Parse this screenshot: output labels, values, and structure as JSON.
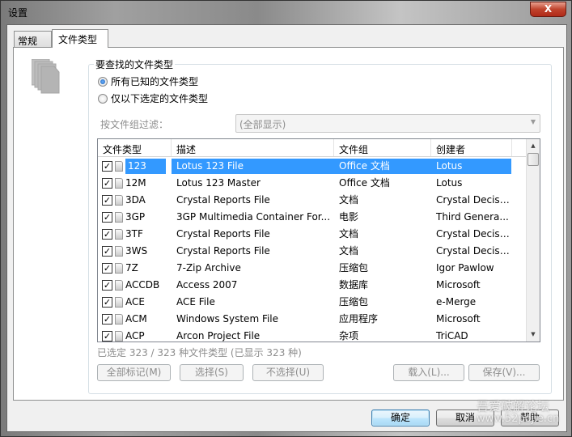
{
  "window": {
    "title": "设置",
    "close_label": "X"
  },
  "tabs": [
    {
      "label": "常规"
    },
    {
      "label": "文件类型"
    }
  ],
  "group": {
    "label": "要查找的文件类型",
    "radio_all": "所有已知的文件类型",
    "radio_selected": "仅以下选定的文件类型",
    "filter_label": "按文件组过滤：",
    "filter_value": "(全部显示)"
  },
  "list": {
    "columns": [
      "文件类型",
      "描述",
      "文件组",
      "创建者"
    ],
    "rows": [
      {
        "type": "123",
        "desc": "Lotus 123 File",
        "group": "Office 文档",
        "creator": "Lotus"
      },
      {
        "type": "12M",
        "desc": "Lotus 123 Master",
        "group": "Office 文档",
        "creator": "Lotus"
      },
      {
        "type": "3DA",
        "desc": "Crystal Reports File",
        "group": "文档",
        "creator": "Crystal Decisi..."
      },
      {
        "type": "3GP",
        "desc": "3GP Multimedia Container For...",
        "group": "电影",
        "creator": "Third Genera..."
      },
      {
        "type": "3TF",
        "desc": "Crystal Reports File",
        "group": "文档",
        "creator": "Crystal Decisi..."
      },
      {
        "type": "3WS",
        "desc": "Crystal Reports File",
        "group": "文档",
        "creator": "Crystal Decisi..."
      },
      {
        "type": "7Z",
        "desc": "7-Zip Archive",
        "group": "压缩包",
        "creator": "Igor Pawlow"
      },
      {
        "type": "ACCDB",
        "desc": "Access 2007",
        "group": "数据库",
        "creator": "Microsoft"
      },
      {
        "type": "ACE",
        "desc": "ACE File",
        "group": "压缩包",
        "creator": "e-Merge"
      },
      {
        "type": "ACM",
        "desc": "Windows System File",
        "group": "应用程序",
        "creator": "Microsoft"
      },
      {
        "type": "ACP",
        "desc": "Arcon Project File",
        "group": "杂项",
        "creator": "TriCAD"
      }
    ]
  },
  "status": "已选定 323 / 323 种文件类型 (已显示 323 种)",
  "list_buttons": {
    "mark_all": "全部标记(M)",
    "select": "选择(S)",
    "deselect": "不选择(U)",
    "load": "载入(L)...",
    "save": "保存(V)..."
  },
  "dialog_buttons": {
    "ok": "确定",
    "cancel": "取消",
    "help": "帮助"
  },
  "watermark": {
    "line1": "吾爱破解论坛",
    "line2": "www.52pojie.cn"
  }
}
